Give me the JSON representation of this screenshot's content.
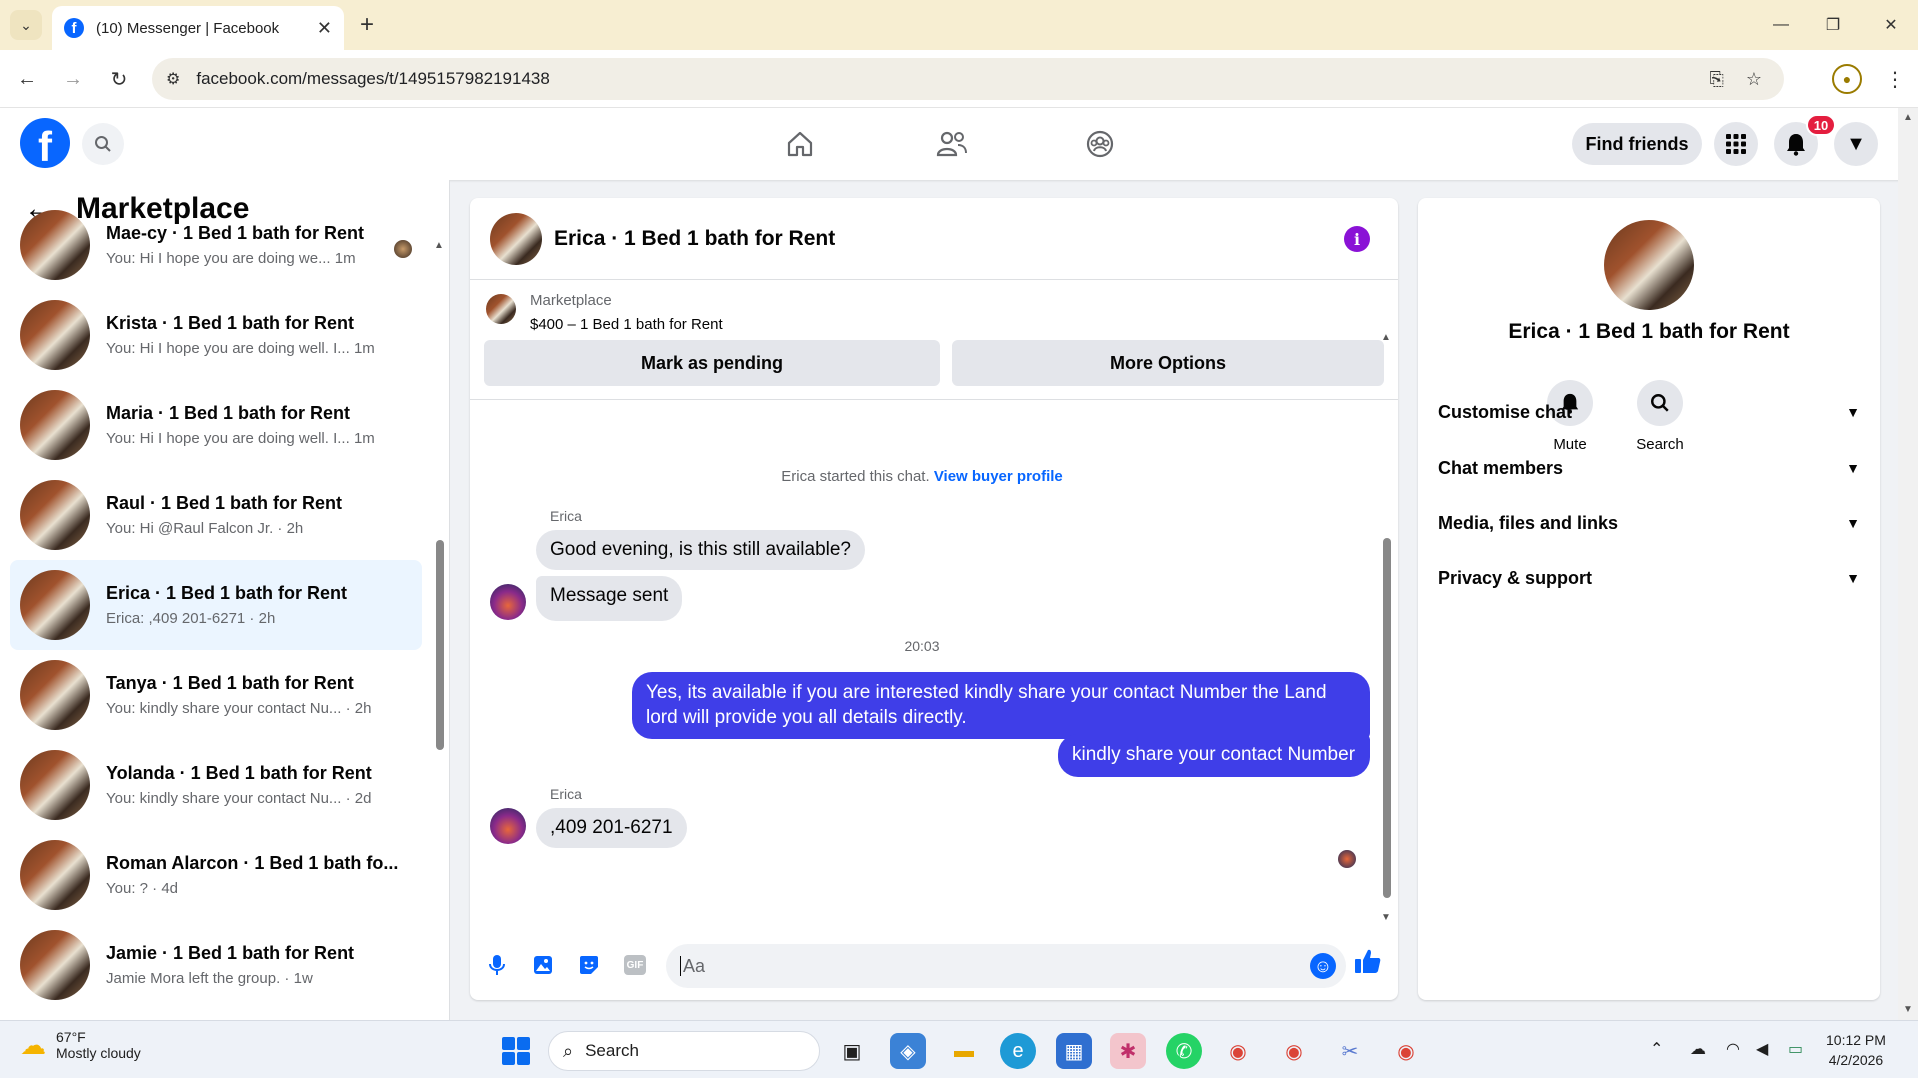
{
  "browser": {
    "tab_title": "(10) Messenger | Facebook",
    "url": "facebook.com/messages/t/1495157982191438"
  },
  "header": {
    "find_friends": "Find friends",
    "notification_count": "10"
  },
  "sidebar": {
    "title": "Marketplace",
    "conversations": [
      {
        "name": "Mae-cy · 1 Bed 1 bath for Rent",
        "preview": "You: Hi I hope you are doing we...",
        "time": "1m",
        "active": false
      },
      {
        "name": "Krista · 1 Bed 1 bath for Rent",
        "preview": "You: Hi I hope you are doing well. I...",
        "time": "1m",
        "active": false
      },
      {
        "name": "Maria · 1 Bed 1 bath for Rent",
        "preview": "You: Hi I hope you are doing well. I...",
        "time": "1m",
        "active": false
      },
      {
        "name": "Raul · 1 Bed 1 bath for Rent",
        "preview": "You: Hi @Raul Falcon Jr.",
        "time": "2h",
        "active": false
      },
      {
        "name": "Erica · 1 Bed 1 bath for Rent",
        "preview": "Erica: ,409 201-6271",
        "time": "2h",
        "active": true
      },
      {
        "name": "Tanya · 1 Bed 1 bath for Rent",
        "preview": "You: kindly share your contact Nu...",
        "time": "2h",
        "active": false
      },
      {
        "name": "Yolanda · 1 Bed 1 bath for Rent",
        "preview": "You: kindly share your contact Nu...",
        "time": "2d",
        "active": false
      },
      {
        "name": "Roman Alarcon · 1 Bed 1 bath fo...",
        "preview": "You: ?",
        "time": "4d",
        "active": false
      },
      {
        "name": "Jamie · 1 Bed 1 bath for Rent",
        "preview": "Jamie Mora left the group.",
        "time": "1w",
        "active": false
      }
    ]
  },
  "chat": {
    "title": "Erica · 1 Bed 1 bath for Rent",
    "listing_source": "Marketplace",
    "listing_title": "$400 – 1 Bed 1 bath for Rent",
    "mark_pending": "Mark as pending",
    "more_options": "More Options",
    "system_note": "Erica started this chat.",
    "view_buyer_profile": "View buyer profile",
    "sender_name": "Erica",
    "msg_in_1": "Good evening, is this still available?",
    "msg_in_2": "Message sent",
    "timestamp": "20:03",
    "msg_out_1": "Yes, its available if you are interested kindly share your contact Number the Land lord will provide you all details directly.",
    "msg_out_2": "kindly share your contact Number",
    "msg_in_3": ",409 201-6271",
    "input_placeholder": "Aa"
  },
  "info_panel": {
    "name": "Erica · 1 Bed 1 bath for Rent",
    "mute": "Mute",
    "search": "Search",
    "sections": [
      "Customise chat",
      "Chat members",
      "Media, files and links",
      "Privacy & support"
    ]
  },
  "taskbar": {
    "temperature": "67°F",
    "weather": "Mostly cloudy",
    "search": "Search",
    "time": "10:12 PM",
    "date": "4/2/2026"
  }
}
